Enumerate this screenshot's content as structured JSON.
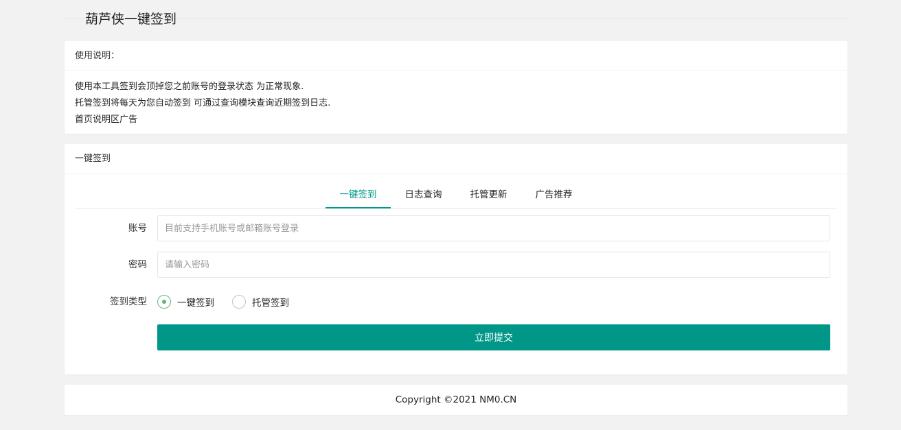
{
  "header": {
    "title": "葫芦侠一键签到"
  },
  "notice": {
    "heading": "使用说明：",
    "lines": [
      "使用本工具签到会顶掉您之前账号的登录状态 为正常现象.",
      "托管签到将每天为您自动签到 可通过查询模块查询近期签到日志.",
      "首页说明区广告"
    ]
  },
  "sign": {
    "heading": "一键签到",
    "tabs": [
      {
        "label": "一键签到",
        "active": true
      },
      {
        "label": "日志查询",
        "active": false
      },
      {
        "label": "托管更新",
        "active": false
      },
      {
        "label": "广告推荐",
        "active": false
      }
    ],
    "account": {
      "label": "账号",
      "placeholder": "目前支持手机账号或邮箱账号登录",
      "value": ""
    },
    "password": {
      "label": "密码",
      "placeholder": "请输入密码",
      "value": ""
    },
    "type": {
      "label": "签到类型",
      "options": [
        {
          "label": "一键签到",
          "checked": true
        },
        {
          "label": "托管签到",
          "checked": false
        }
      ]
    },
    "submit_label": "立即提交"
  },
  "footer": {
    "copyright": "Copyright ©2021 NM0.CN"
  },
  "colors": {
    "accent": "#009688",
    "radio": "#5fb878",
    "background": "#f2f2f2"
  }
}
